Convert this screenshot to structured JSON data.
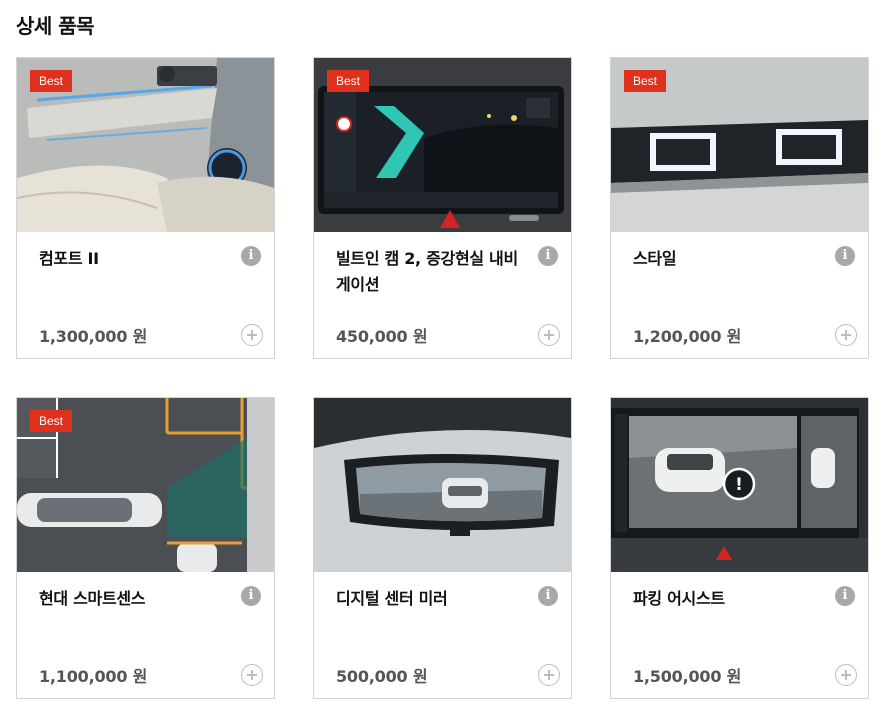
{
  "page": {
    "section_title": "상세 품목"
  },
  "colors": {
    "badge": "#e0301e",
    "info": "#a8a8a8",
    "price": "#555555"
  },
  "items": [
    {
      "name": "컴포트 II",
      "badge": "Best",
      "price": "1,300,000 원",
      "image": "interior-door-seat"
    },
    {
      "name": "빌트인 캠 2, 증강현실 내비게이션",
      "badge": "Best",
      "price": "450,000 원",
      "image": "ar-navigation-screen"
    },
    {
      "name": "스타일",
      "badge": "Best",
      "price": "1,200,000 원",
      "image": "pixel-headlamp"
    },
    {
      "name": "현대 스마트센스",
      "badge": "Best",
      "price": "1,100,000 원",
      "image": "parking-lot-topview"
    },
    {
      "name": "디지털 센터 미러",
      "badge": "",
      "price": "500,000 원",
      "image": "digital-rear-mirror"
    },
    {
      "name": "파킹 어시스트",
      "badge": "",
      "price": "1,500,000 원",
      "image": "parking-assist-screen"
    }
  ]
}
